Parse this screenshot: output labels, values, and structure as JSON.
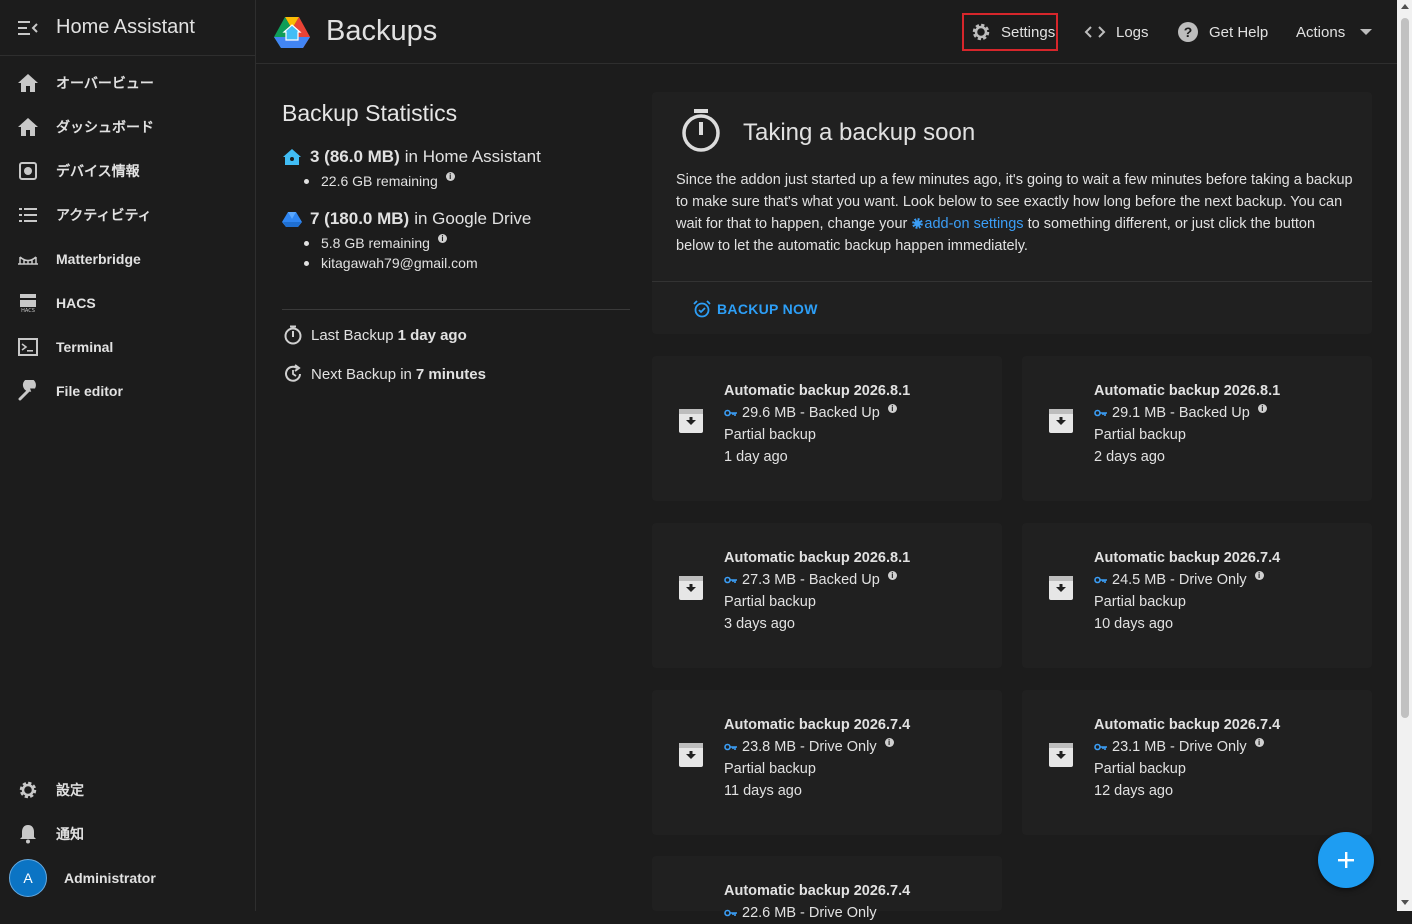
{
  "sidebar": {
    "title": "Home Assistant",
    "items": [
      {
        "label": "オーバービュー",
        "icon": "home-icon"
      },
      {
        "label": "ダッシュボード",
        "icon": "home-icon"
      },
      {
        "label": "デバイス情報",
        "icon": "device-icon"
      },
      {
        "label": "アクティビティ",
        "icon": "list-icon"
      },
      {
        "label": "Matterbridge",
        "icon": "bridge-icon"
      },
      {
        "label": "HACS",
        "icon": "hacs-icon"
      },
      {
        "label": "Terminal",
        "icon": "terminal-icon"
      },
      {
        "label": "File editor",
        "icon": "wrench-icon"
      }
    ],
    "bottom": [
      {
        "label": "設定",
        "icon": "gear-icon"
      },
      {
        "label": "通知",
        "icon": "bell-icon"
      }
    ],
    "user": {
      "initial": "A",
      "name": "Administrator"
    }
  },
  "header": {
    "title": "Backups",
    "settings_label": "Settings",
    "logs_label": "Logs",
    "help_label": "Get Help",
    "actions_label": "Actions"
  },
  "stats": {
    "title": "Backup Statistics",
    "ha_count": "3 (86.0 MB)",
    "ha_suffix": "in Home Assistant",
    "ha_remaining": "22.6 GB remaining",
    "drive_count": "7 (180.0 MB)",
    "drive_suffix": "in Google Drive",
    "drive_remaining": "5.8 GB remaining",
    "drive_account": "kitagawah79@gmail.com",
    "last_label": "Last Backup",
    "last_value": "1 day ago",
    "next_label": "Next Backup in",
    "next_value": "7 minutes"
  },
  "soon": {
    "title": "Taking a backup soon",
    "body_1": "Since the addon just started up a few minutes ago, it's going to wait a few minutes before taking a backup to make sure that's what you want. Look below to see exactly how long before the next backup. You can wait for that to happen, change your",
    "link": "add-on settings",
    "body_2": "to something different, or just click the button below to let the automatic backup happen immediately.",
    "button": "BACKUP NOW"
  },
  "backups": [
    {
      "name": "Automatic backup 2026.8.1",
      "status": "29.6 MB - Backed Up",
      "type": "Partial backup",
      "age": "1 day ago"
    },
    {
      "name": "Automatic backup 2026.8.1",
      "status": "29.1 MB - Backed Up",
      "type": "Partial backup",
      "age": "2 days ago"
    },
    {
      "name": "Automatic backup 2026.8.1",
      "status": "27.3 MB - Backed Up",
      "type": "Partial backup",
      "age": "3 days ago"
    },
    {
      "name": "Automatic backup 2026.7.4",
      "status": "24.5 MB - Drive Only",
      "type": "Partial backup",
      "age": "10 days ago"
    },
    {
      "name": "Automatic backup 2026.7.4",
      "status": "23.8 MB - Drive Only",
      "type": "Partial backup",
      "age": "11 days ago"
    },
    {
      "name": "Automatic backup 2026.7.4",
      "status": "23.1 MB - Drive Only",
      "type": "Partial backup",
      "age": "12 days ago"
    },
    {
      "name": "Automatic backup 2026.7.4",
      "status": "22.6 MB - Drive Only",
      "type": "",
      "age": ""
    }
  ],
  "colors": {
    "accent": "#2d9ff7",
    "settings_outline": "#d6262b",
    "fab": "#1e9df2"
  }
}
